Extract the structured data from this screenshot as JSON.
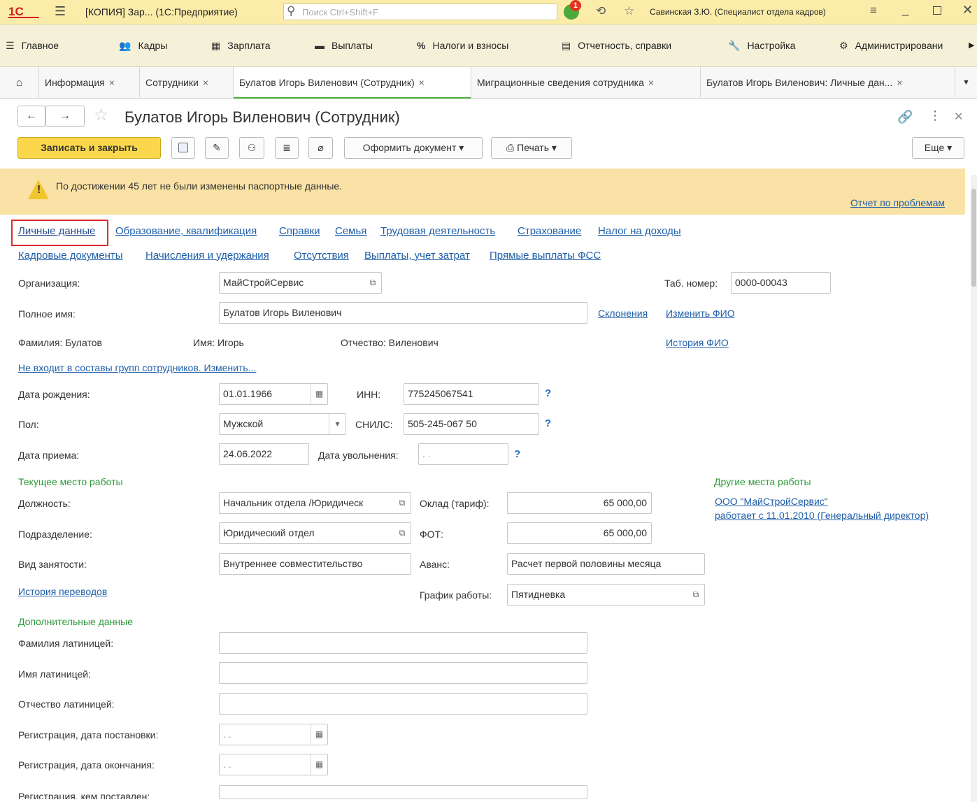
{
  "app": {
    "logo": "1С",
    "title": "[КОПИЯ] Зар... (1С:Предприятие)",
    "search_placeholder": "Поиск Ctrl+Shift+F",
    "notifications_count": "1",
    "user": "Савинская З.Ю. (Специалист отдела кадров)"
  },
  "sections": [
    {
      "label": "Главное",
      "icon": "menu-icon"
    },
    {
      "label": "Кадры",
      "icon": "people-icon"
    },
    {
      "label": "Зарплата",
      "icon": "calculator-icon"
    },
    {
      "label": "Выплаты",
      "icon": "wallet-icon"
    },
    {
      "label": "Налоги и взносы",
      "icon": "percent-icon"
    },
    {
      "label": "Отчетность, справки",
      "icon": "report-icon"
    },
    {
      "label": "Настройка",
      "icon": "wrench-icon"
    },
    {
      "label": "Администрировани",
      "icon": "gear-icon"
    }
  ],
  "tabs": [
    {
      "label": "Информация"
    },
    {
      "label": "Сотрудники"
    },
    {
      "label": "Булатов Игорь Виленович (Сотрудник)"
    },
    {
      "label": "Миграционные сведения сотрудника"
    },
    {
      "label": "Булатов Игорь Виленович: Личные дан..."
    }
  ],
  "doc": {
    "title": "Булатов Игорь Виленович (Сотрудник)",
    "save_close": "Записать и закрыть",
    "make_doc": "Оформить документ",
    "print": "Печать",
    "more": "Еще",
    "warning": "По достижении 45 лет не были изменены паспортные данные.",
    "report_link": "Отчет по проблемам"
  },
  "links_row1": [
    "Личные данные",
    "Образование, квалификация",
    "Справки",
    "Семья",
    "Трудовая деятельность",
    "Страхование",
    "Налог на доходы"
  ],
  "links_row2": [
    "Кадровые документы",
    "Начисления и удержания",
    "Отсутствия",
    "Выплаты, учет затрат",
    "Прямые выплаты ФСС"
  ],
  "form": {
    "org_label": "Организация:",
    "org_value": "МайСтройСервис",
    "tab_label": "Таб. номер:",
    "tab_value": "0000-00043",
    "fullname_label": "Полное имя:",
    "fullname_value": "Булатов Игорь Виленович",
    "declensions": "Склонения",
    "change_fio": "Изменить ФИО",
    "surname": "Фамилия: Булатов",
    "name": "Имя: Игорь",
    "patronymic": "Отчество: Виленович",
    "fio_history": "История ФИО",
    "groups_link": "Не входит в составы групп сотрудников. Изменить...",
    "birth_label": "Дата рождения:",
    "birth_value": "01.01.1966",
    "inn_label": "ИНН:",
    "inn_value": "775245067541",
    "sex_label": "Пол:",
    "sex_value": "Мужской",
    "snils_label": "СНИЛС:",
    "snils_value": "505-245-067 50",
    "hire_label": "Дата приема:",
    "hire_value": "24.06.2022",
    "fire_label": "Дата увольнения:",
    "fire_value": " .  .",
    "current_work": "Текущее место работы",
    "other_work": "Другие места работы",
    "other_org": "ООО \"МайСтройСервис\"",
    "other_since": "работает с 11.01.2010 (Генеральный директор)",
    "position_label": "Должность:",
    "position_value": "Начальник отдела /Юридическ",
    "salary_label": "Оклад (тариф):",
    "salary_value": "65 000,00",
    "dept_label": "Подразделение:",
    "dept_value": "Юридический отдел",
    "fot_label": "ФОТ:",
    "fot_value": "65 000,00",
    "emp_label": "Вид занятости:",
    "emp_value": "Внутреннее совместительство",
    "advance_label": "Аванс:",
    "advance_value": "Расчет первой половины месяца",
    "transfers_link": "История переводов",
    "schedule_label": "График работы:",
    "schedule_value": "Пятидневка",
    "extra": "Дополнительные данные",
    "lat_surname": "Фамилия латиницей:",
    "lat_name": "Имя латиницей:",
    "lat_patronymic": "Отчество латиницей:",
    "reg_start": "Регистрация, дата постановки:",
    "reg_end": "Регистрация, дата окончания:",
    "reg_by": "Регистрация, кем поставлен:",
    "empty_date": " .  ."
  }
}
